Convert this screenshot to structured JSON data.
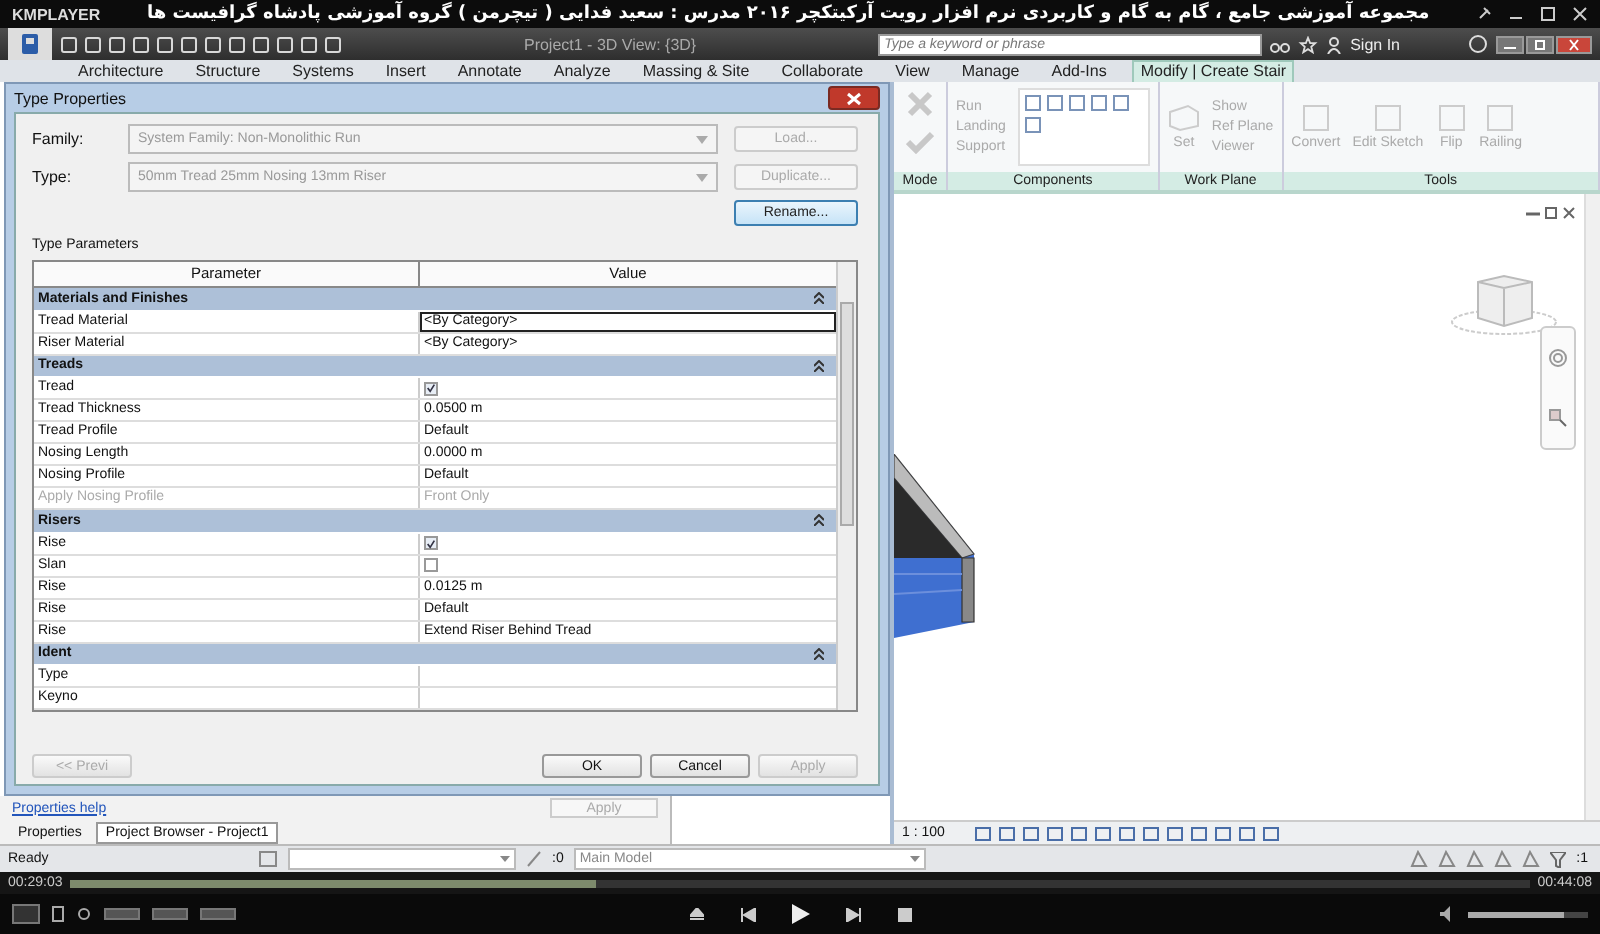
{
  "player": {
    "logo": "KMPLAYER",
    "title": "مجموعه آموزشی جامع ، گام به گام و کاربردی نرم افزار رویت آرکیتکچر ۲۰۱۶   مدرس : سعید فدایی ( تیچرمن ) گروه آموزشی پادشاه گرافیست ها",
    "elapsed": "00:29:03",
    "total": "00:44:08",
    "progress": {
      "level": 0.36
    },
    "volume": {
      "level": 0.8
    }
  },
  "app": {
    "title": "Project1 - 3D View: {3D}",
    "search": {
      "placeholder": "Type a keyword or phrase"
    },
    "sign_in": "Sign In"
  },
  "tabs": [
    {
      "label": "Architecture",
      "selected": false
    },
    {
      "label": "Structure",
      "selected": false
    },
    {
      "label": "Systems",
      "selected": false
    },
    {
      "label": "Insert",
      "selected": false
    },
    {
      "label": "Annotate",
      "selected": false
    },
    {
      "label": "Analyze",
      "selected": false
    },
    {
      "label": "Massing & Site",
      "selected": false
    },
    {
      "label": "Collaborate",
      "selected": false
    },
    {
      "label": "View",
      "selected": false
    },
    {
      "label": "Manage",
      "selected": false
    },
    {
      "label": "Add-Ins",
      "selected": false
    },
    {
      "label": "Modify | Create Stair",
      "selected": true
    }
  ],
  "ribbon": {
    "mode": {
      "label": "Mode"
    },
    "components": {
      "label": "Components",
      "tools": [
        "Run",
        "Landing",
        "Support"
      ]
    },
    "work_plane": {
      "label": "Work Plane",
      "set": "Set",
      "tools": [
        "Show",
        "Ref Plane",
        "Viewer"
      ]
    },
    "tools": {
      "label": "Tools",
      "tools": [
        "Convert",
        "Edit Sketch",
        "Flip",
        "Railing"
      ]
    }
  },
  "dialog": {
    "title": "Type Properties",
    "family": {
      "label": "Family:",
      "value": "System Family: Non-Monolithic Run"
    },
    "type": {
      "label": "Type:",
      "value": "50mm Tread 25mm Nosing 13mm Riser"
    },
    "side_buttons": [
      {
        "label": "Load...",
        "disabled": true
      },
      {
        "label": "Duplicate...",
        "disabled": true
      },
      {
        "label": "Rename...",
        "disabled": false
      }
    ],
    "section": "Type Parameters",
    "columns": [
      "Parameter",
      "Value"
    ],
    "rows": [
      {
        "kind": "group",
        "label": "Materials and Finishes"
      },
      {
        "kind": "text",
        "label": "Tread Material",
        "value": "<By Category>",
        "selected": true,
        "disabled": false
      },
      {
        "kind": "text",
        "label": "Riser Material",
        "value": "<By Category>",
        "selected": false,
        "disabled": false
      },
      {
        "kind": "group",
        "label": "Treads"
      },
      {
        "kind": "check",
        "label": "Tread",
        "checked": true,
        "selected": false,
        "disabled": false
      },
      {
        "kind": "text",
        "label": "Tread Thickness",
        "value": "0.0500 m",
        "selected": false,
        "disabled": false
      },
      {
        "kind": "text",
        "label": "Tread Profile",
        "value": "Default",
        "selected": false,
        "disabled": false
      },
      {
        "kind": "text",
        "label": "Nosing Length",
        "value": "0.0000 m",
        "selected": false,
        "disabled": false
      },
      {
        "kind": "text",
        "label": "Nosing Profile",
        "value": "Default",
        "selected": false,
        "disabled": false
      },
      {
        "kind": "text",
        "label": "Apply Nosing Profile",
        "value": "Front Only",
        "selected": false,
        "disabled": true
      },
      {
        "kind": "group",
        "label": "Risers"
      },
      {
        "kind": "check",
        "label": "Rise",
        "checked": true,
        "selected": false,
        "disabled": false
      },
      {
        "kind": "check",
        "label": "Slan",
        "checked": false,
        "selected": false,
        "disabled": false
      },
      {
        "kind": "text",
        "label": "Rise",
        "value": "0.0125 m",
        "selected": false,
        "disabled": false
      },
      {
        "kind": "text",
        "label": "Rise",
        "value": "Default",
        "selected": false,
        "disabled": false
      },
      {
        "kind": "text",
        "label": "Rise",
        "value": "Extend Riser Behind Tread",
        "selected": false,
        "disabled": false
      },
      {
        "kind": "group",
        "label": "Ident"
      },
      {
        "kind": "text",
        "label": "Type",
        "selected": false,
        "disabled": false
      },
      {
        "kind": "text",
        "label": "Keyno",
        "selected": false,
        "disabled": false
      }
    ],
    "buttons": [
      {
        "label": "<< Previ",
        "disabled": true
      },
      {
        "label": "OK",
        "disabled": false
      },
      {
        "label": "Cancel",
        "disabled": false
      },
      {
        "label": "Apply",
        "disabled": true
      }
    ]
  },
  "properties": {
    "help_link": "Properties help",
    "apply": {
      "label": "Apply",
      "disabled": true
    },
    "tabs": [
      {
        "label": "Properties",
        "selected": false
      },
      {
        "label": "Project Browser - Project1",
        "selected": true
      }
    ]
  },
  "view": {
    "scale": "1 : 100"
  },
  "status": {
    "text": "Ready",
    "selection_count": ":0",
    "workset": "Main Model",
    "filter_count": ":1"
  }
}
